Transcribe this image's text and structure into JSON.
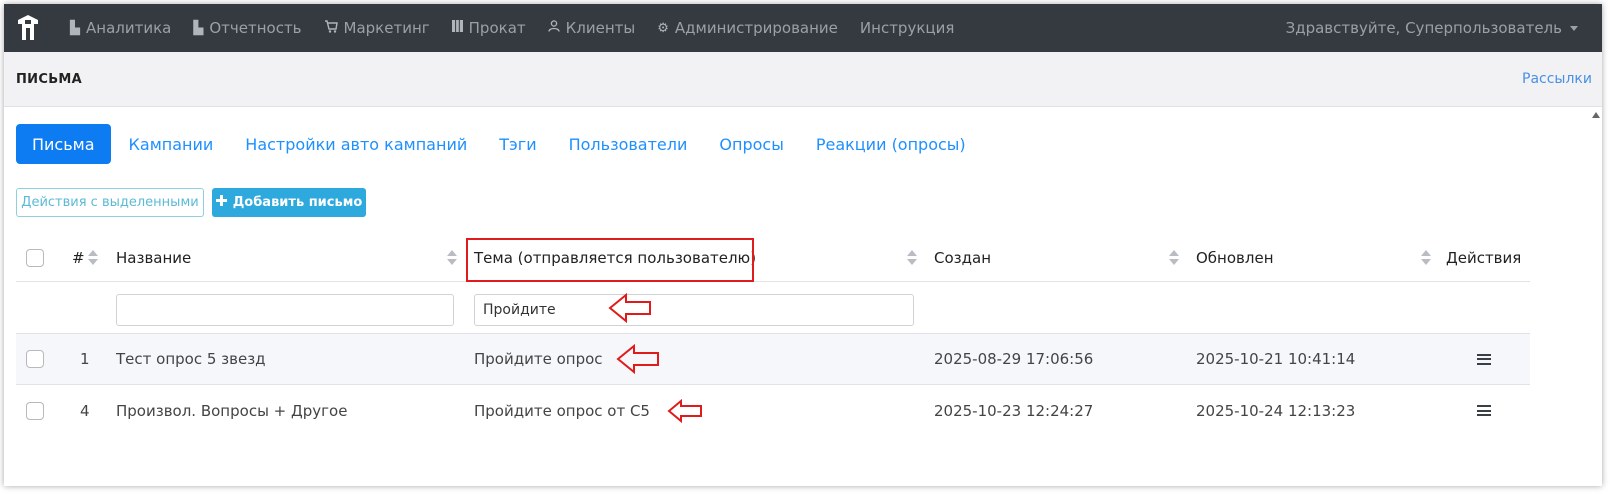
{
  "nav": {
    "items": [
      {
        "label": "Аналитика",
        "icon": "bar-chart-icon"
      },
      {
        "label": "Отчетность",
        "icon": "bar-chart-icon"
      },
      {
        "label": "Маркетинг",
        "icon": "cart-icon"
      },
      {
        "label": "Прокат",
        "icon": "grid-icon"
      },
      {
        "label": "Клиенты",
        "icon": "user-icon"
      },
      {
        "label": "Администрирование",
        "icon": "gears-icon"
      },
      {
        "label": "Инструкция",
        "icon": ""
      }
    ],
    "user_greeting": "Здравствуйте, Суперпользователь"
  },
  "page": {
    "title": "ПИСЬМА",
    "header_link": "Рассылки"
  },
  "tabs": [
    {
      "label": "Письма",
      "active": true
    },
    {
      "label": "Кампании",
      "active": false
    },
    {
      "label": "Настройки авто кампаний",
      "active": false
    },
    {
      "label": "Тэги",
      "active": false
    },
    {
      "label": "Пользователи",
      "active": false
    },
    {
      "label": "Опросы",
      "active": false
    },
    {
      "label": "Реакции (опросы)",
      "active": false
    }
  ],
  "toolbar": {
    "bulk_actions_label": "Действия с выделенными",
    "add_label": "Добавить письмо"
  },
  "table": {
    "columns": {
      "id": "#",
      "name": "Название",
      "subject": "Тема (отправляется пользователю)",
      "created": "Создан",
      "updated": "Обновлен",
      "actions": "Действия"
    },
    "filters": {
      "name_value": "",
      "subject_value": "Пройдите"
    },
    "rows": [
      {
        "id": "1",
        "name": "Тест опрос 5 звезд",
        "subject": "Пройдите опрос",
        "created": "2025-08-29 17:06:56",
        "updated": "2025-10-21 10:41:14"
      },
      {
        "id": "4",
        "name": "Произвол. Вопросы + Другое",
        "subject": "Пройдите опрос от С5",
        "created": "2025-10-23 12:24:27",
        "updated": "2025-10-24 12:13:23"
      }
    ]
  },
  "colors": {
    "navbar": "#343a40",
    "accent": "#0d7cf2",
    "annotation": "#e01b1b"
  }
}
